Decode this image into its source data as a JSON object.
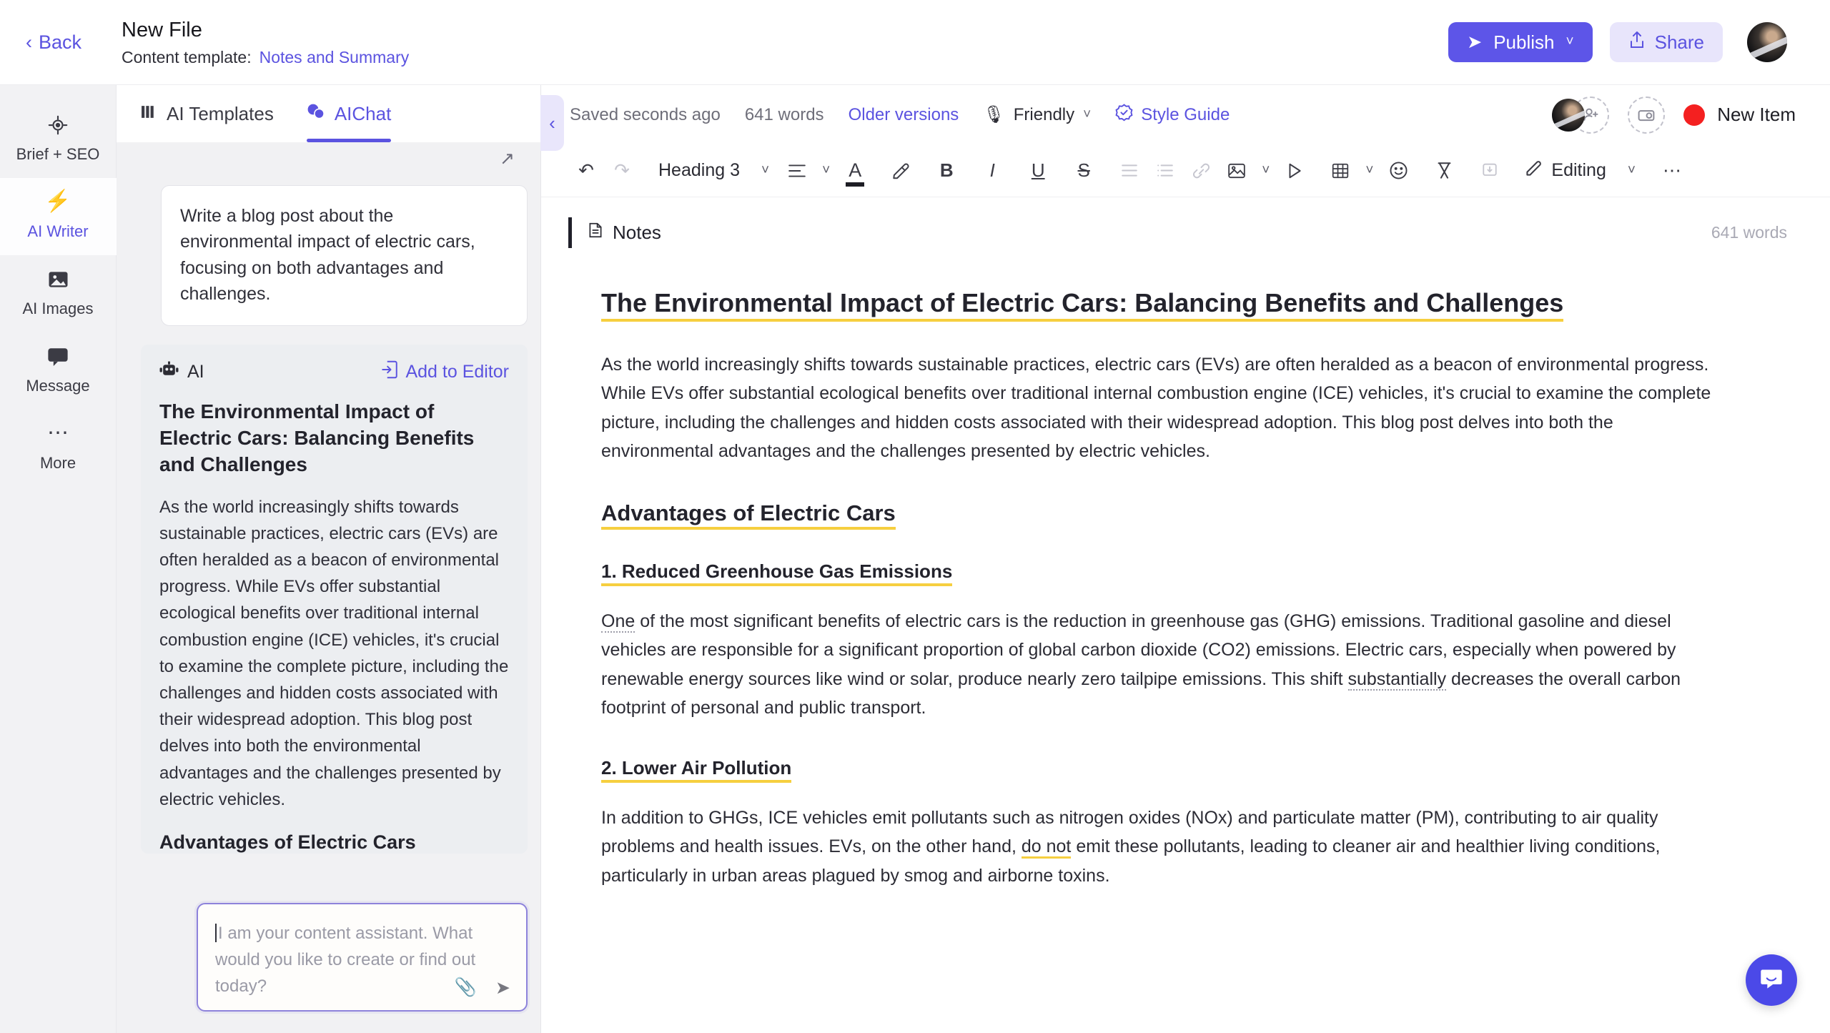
{
  "header": {
    "back_label": "Back",
    "file_title": "New File",
    "template_label": "Content template:",
    "template_name": "Notes and Summary",
    "publish_label": "Publish",
    "share_label": "Share"
  },
  "rail": {
    "items": [
      {
        "label": "Brief + SEO",
        "icon": "target-icon"
      },
      {
        "label": "AI Writer",
        "icon": "lightning-icon"
      },
      {
        "label": "AI Images",
        "icon": "image-icon"
      },
      {
        "label": "Message",
        "icon": "chat-bubble-icon"
      },
      {
        "label": "More",
        "icon": "ellipsis-icon"
      }
    ]
  },
  "ai_panel": {
    "tabs": [
      {
        "label": "AI Templates",
        "icon": "grid-icon",
        "active": false
      },
      {
        "label": "AIChat",
        "icon": "chat-icon",
        "active": true
      }
    ],
    "user_message": "Write a blog post about the environmental impact of electric cars, focusing on both advantages and challenges.",
    "ai_label": "AI",
    "add_to_editor_label": "Add to Editor",
    "ai_heading": "The Environmental Impact of Electric Cars: Balancing Benefits and Challenges",
    "ai_paragraph": "As the world increasingly shifts towards sustainable practices, electric cars (EVs) are often heralded as a beacon of environmental progress. While EVs offer substantial ecological benefits over traditional internal combustion engine (ICE) vehicles, it's crucial to examine the complete picture, including the challenges and hidden costs associated with their widespread adoption. This blog post delves into both the environmental advantages and the challenges presented by electric vehicles.",
    "ai_next_heading": "Advantages of Electric Cars",
    "chat_placeholder": "I am your content assistant. What would you like to create or find out today?"
  },
  "editor_status": {
    "saved": "Saved seconds ago",
    "word_count": "641 words",
    "older_versions": "Older versions",
    "tone": "Friendly",
    "style_guide": "Style Guide",
    "record_label": "New Item"
  },
  "toolbar": {
    "block_style": "Heading 3",
    "mode": "Editing"
  },
  "notes_section": {
    "title": "Notes",
    "word_count": "641 words"
  },
  "document": {
    "title": "The Environmental Impact of Electric Cars: Balancing Benefits and Challenges",
    "intro": "As the world increasingly shifts towards sustainable practices, electric cars (EVs) are often heralded as a beacon of environmental progress. While EVs offer substantial ecological benefits over traditional internal combustion engine (ICE) vehicles, it's crucial to examine the complete picture, including the challenges and hidden costs associated with their widespread adoption. This blog post delves into both the environmental advantages and the challenges presented by electric vehicles.",
    "section1_heading": "Advantages of Electric Cars",
    "sub1_heading": "1. Reduced Greenhouse Gas Emissions",
    "sub1_p_a": "One",
    "sub1_p_b": " of the most significant benefits of electric cars is the reduction in greenhouse gas (GHG) emissions. Traditional gasoline and diesel vehicles are responsible for a significant proportion of global carbon dioxide (CO2) emissions. Electric cars, especially when powered by renewable energy sources like wind or solar, produce nearly zero tailpipe emissions. This shift ",
    "sub1_p_c": "substantially",
    "sub1_p_d": " decreases the overall carbon footprint of personal and public transport.",
    "sub2_heading": "2. Lower Air Pollution",
    "sub2_p_a": "In addition to GHGs, ICE vehicles emit pollutants such as nitrogen oxides (NOx) and particulate matter (PM), contributing to air quality problems and health issues. EVs, on the other hand, ",
    "sub2_p_b": "do not",
    "sub2_p_c": " emit these pollutants, leading to cleaner air and healthier living conditions, particularly in urban areas plagued by smog and airborne toxins."
  },
  "colors": {
    "accent": "#5b53e0",
    "publish_bg": "#5d55e8",
    "share_bg": "#e8e5fb",
    "highlight": "#f6cf3f",
    "record_red": "#f42020",
    "intercom": "#4b49e8"
  }
}
